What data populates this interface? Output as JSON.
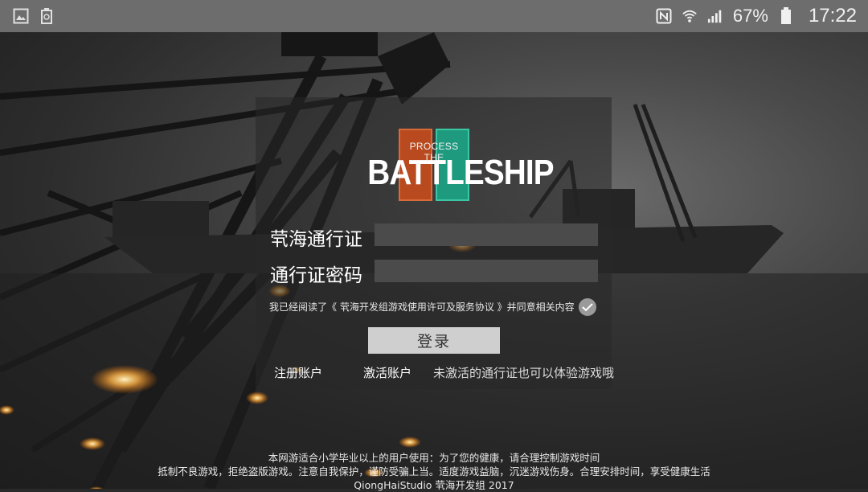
{
  "statusbar": {
    "left_icons": [
      "image-icon",
      "recycle-icon"
    ],
    "battery_percent": "67%",
    "time": "17:22"
  },
  "logo": {
    "small_text": "PROCESS THE",
    "big_text": "BATTLESHIP",
    "colors": {
      "left": "#b94a1f",
      "right": "#1e9a7e"
    }
  },
  "form": {
    "account_label": "茕海通行证",
    "account_value": "",
    "password_label": "通行证密码",
    "password_value": "",
    "agreement_text": "我已经阅读了《 茕海开发组游戏使用许可及服务协议 》并同意相关内容",
    "agreement_checked": true,
    "login_button": "登录",
    "register_link": "注册账户",
    "activate_link": "激活账户",
    "hint_text": "未激活的通行证也可以体验游戏哦"
  },
  "footer": {
    "line1": "本网游适合小学毕业以上的用户使用：为了您的健康，请合理控制游戏时间",
    "line2": "抵制不良游戏，拒绝盗版游戏。注意自我保护，谨防受骗上当。适度游戏益脑，沉迷游戏伤身。合理安排时间，享受健康生活",
    "line3": "QiongHaiStudio 茕海开发组 2017"
  }
}
